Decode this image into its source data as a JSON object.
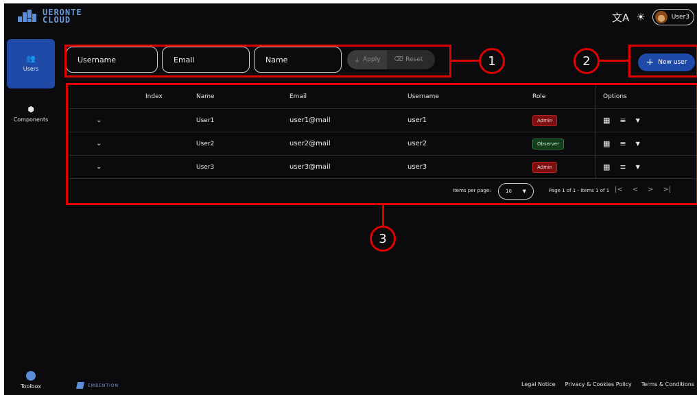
{
  "app": {
    "logo_line1": "UERONTE",
    "logo_line2": "CLOUD"
  },
  "topbar": {
    "translate_icon": "translate-icon",
    "theme_icon": "sun-icon",
    "user_label": "User3"
  },
  "sidebar": {
    "items": [
      {
        "label": "Users",
        "icon": "users-icon",
        "active": true
      },
      {
        "label": "Components",
        "icon": "cube-icon",
        "active": false
      }
    ],
    "toolbox_label": "Toolbox"
  },
  "filters": {
    "username_placeholder": "Username",
    "email_placeholder": "Email",
    "name_placeholder": "Name",
    "apply_label": "Apply",
    "reset_label": "Reset"
  },
  "actions": {
    "new_user_label": "New user"
  },
  "annotations": [
    "1",
    "2",
    "3"
  ],
  "table": {
    "headers": {
      "index": "Index",
      "name": "Name",
      "email": "Email",
      "username": "Username",
      "role": "Role",
      "options": "Options"
    },
    "rows": [
      {
        "name": "User1",
        "email": "user1@mail",
        "username": "user1",
        "role": "Admin"
      },
      {
        "name": "User2",
        "email": "user2@mail",
        "username": "user2",
        "role": "Observer"
      },
      {
        "name": "User3",
        "email": "user3@mail",
        "username": "user3",
        "role": "Admin"
      }
    ],
    "pager": {
      "items_per_page_label": "Items per page:",
      "items_per_page_value": "10",
      "page_info": "Page 1 of 1 - Items 1 of 1"
    }
  },
  "footer": {
    "brand": "EMBENTION",
    "links": [
      "Legal Notice",
      "Privacy & Cookies Policy",
      "Terms & Conditions"
    ]
  },
  "colors": {
    "background": "#0b0b0d",
    "accent": "#1f4aa8",
    "annotation": "#e00000",
    "admin_badge": "#7a0f0f",
    "observer_badge": "#133d1c"
  }
}
